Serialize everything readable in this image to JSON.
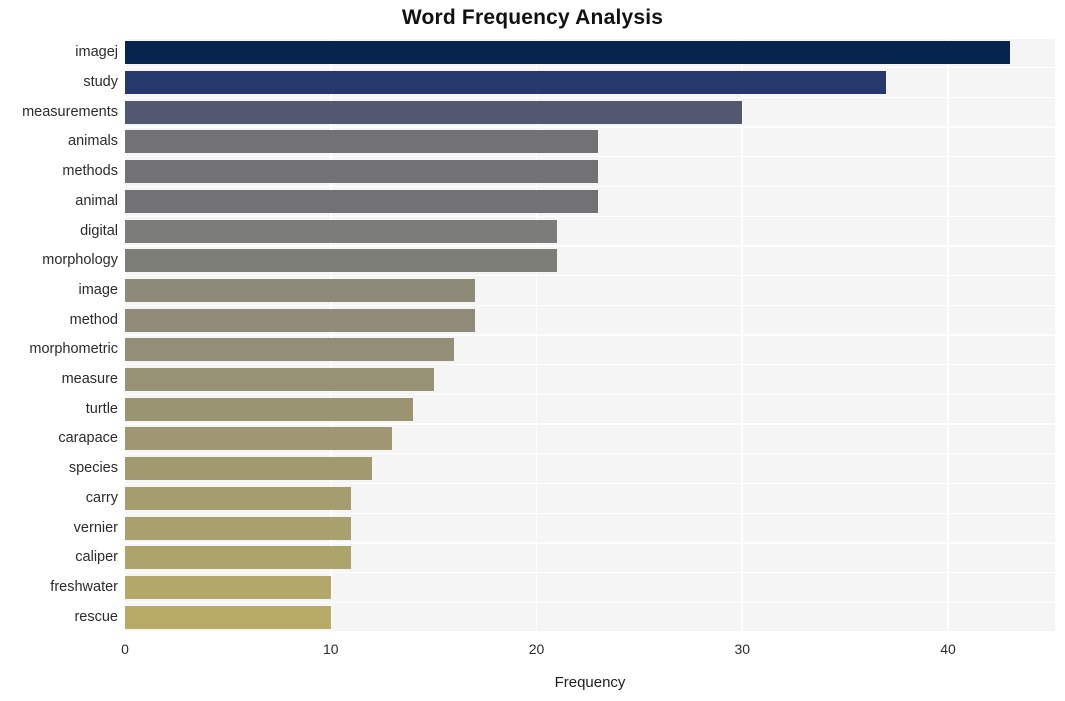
{
  "chart_data": {
    "type": "bar",
    "orientation": "horizontal",
    "title": "Word Frequency Analysis",
    "xlabel": "Frequency",
    "ylabel": "",
    "categories": [
      "imagej",
      "study",
      "measurements",
      "animals",
      "methods",
      "animal",
      "digital",
      "morphology",
      "image",
      "method",
      "morphometric",
      "measure",
      "turtle",
      "carapace",
      "species",
      "carry",
      "vernier",
      "caliper",
      "freshwater",
      "rescue"
    ],
    "values": [
      43,
      37,
      30,
      23,
      23,
      23,
      21,
      21,
      17,
      17,
      16,
      15,
      14,
      13,
      12,
      11,
      11,
      11,
      10,
      10
    ],
    "bar_colors": [
      "#07244f",
      "#27386c",
      "#535871",
      "#727274",
      "#727274",
      "#727274",
      "#7c7c78",
      "#7e7e78",
      "#8d8a7a",
      "#908c79",
      "#938e77",
      "#979176",
      "#9a9473",
      "#9e9772",
      "#a19a70",
      "#a59d6f",
      "#a9a16d",
      "#ada46b",
      "#b2a869",
      "#b7ab67"
    ],
    "xticks": [
      0,
      10,
      20,
      30,
      40
    ],
    "xtick_labels": [
      "0",
      "10",
      "20",
      "30",
      "40"
    ],
    "xlim": [
      0,
      45.2
    ],
    "grid": true,
    "grid_color": "#ffffff",
    "plot_background": "#f5f5f5",
    "legend": null
  }
}
